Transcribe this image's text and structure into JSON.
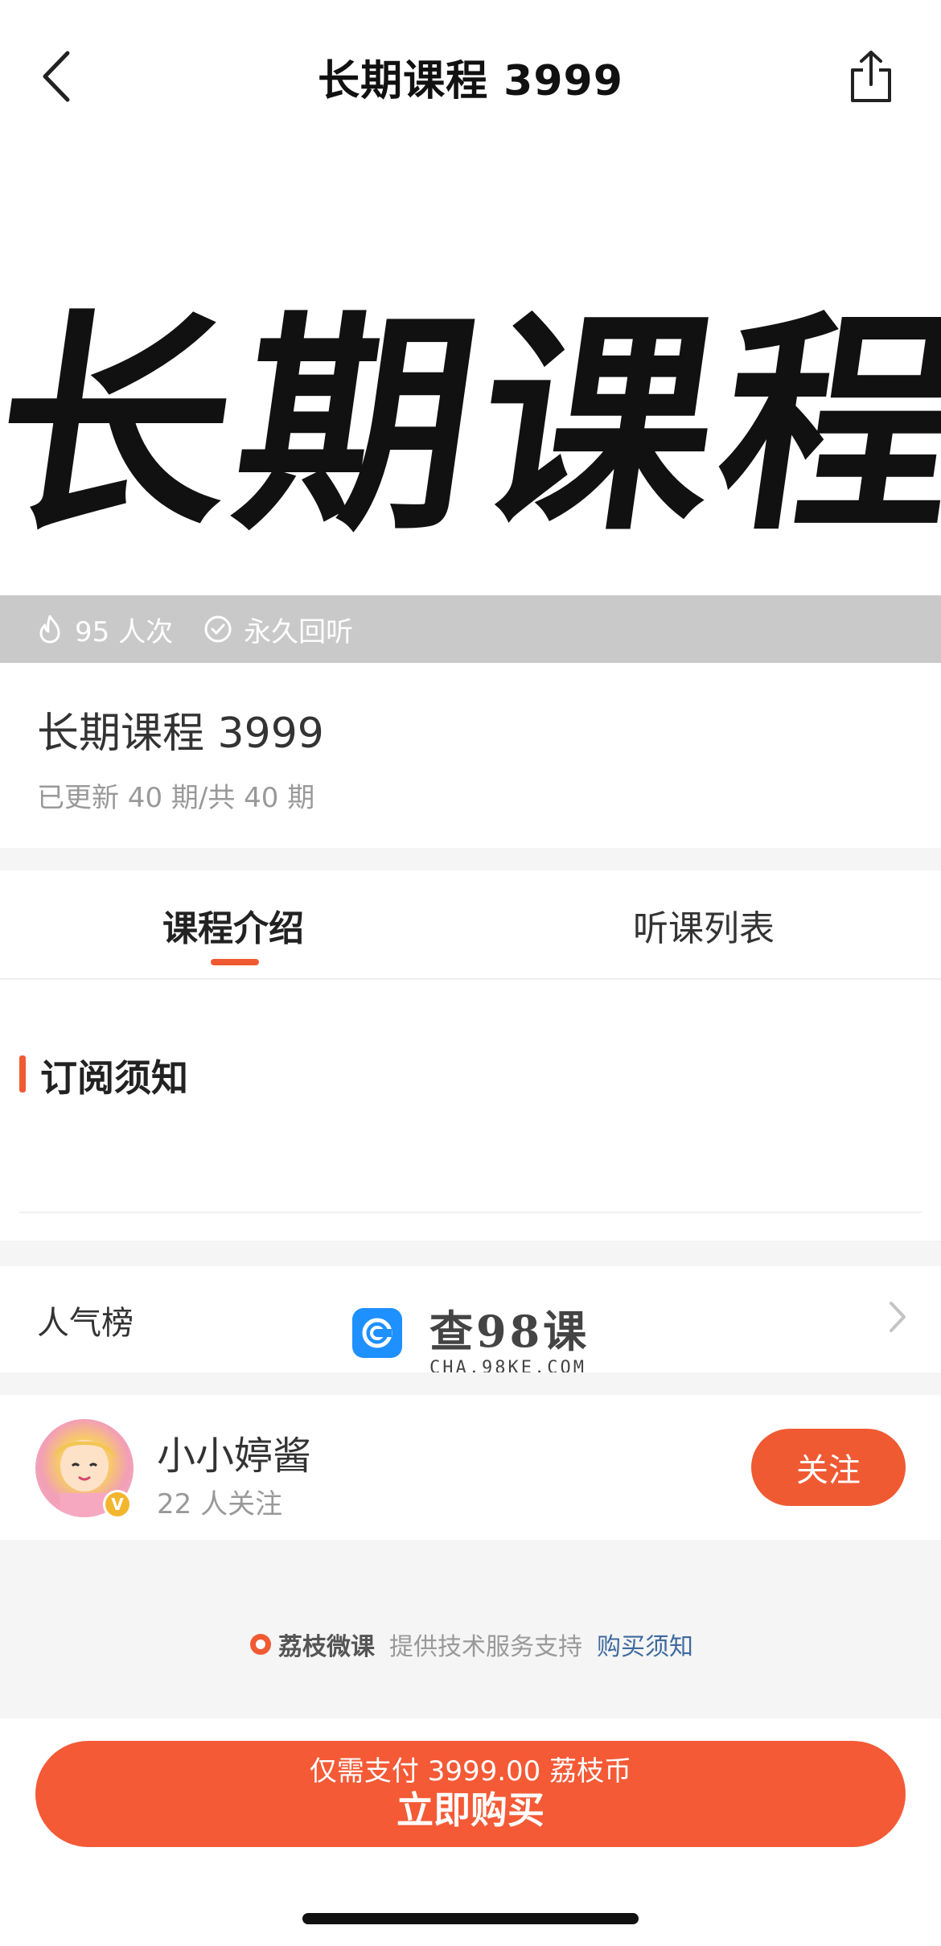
{
  "nav": {
    "title": "长期课程 3999",
    "back_icon": "chevron-left-icon",
    "share_icon": "share-icon"
  },
  "banner": {
    "art_text": "长期课程"
  },
  "stats": {
    "views": "95 人次",
    "replay": "永久回听"
  },
  "course": {
    "title": "长期课程 3999",
    "progress": "已更新 40 期/共 40 期"
  },
  "tabs": [
    {
      "label": "课程介绍",
      "active": true
    },
    {
      "label": "听课列表",
      "active": false
    }
  ],
  "notice": {
    "title": "订阅须知"
  },
  "popular": {
    "label": "人气榜",
    "watermark_main": "查98课",
    "watermark_sub": "CHA.98KE.COM"
  },
  "author": {
    "name": "小小婷酱",
    "followers": "22 人关注",
    "follow_label": "关注"
  },
  "support": {
    "brand": "荔枝微课",
    "text": "提供技术服务支持",
    "link": "购买须知"
  },
  "cta": {
    "price_line": "仅需支付 3999.00 荔枝币",
    "label": "立即购买"
  },
  "colors": {
    "accent": "#f05a33",
    "link": "#3f6a9e",
    "stats_bg": "#c9c9c9"
  }
}
